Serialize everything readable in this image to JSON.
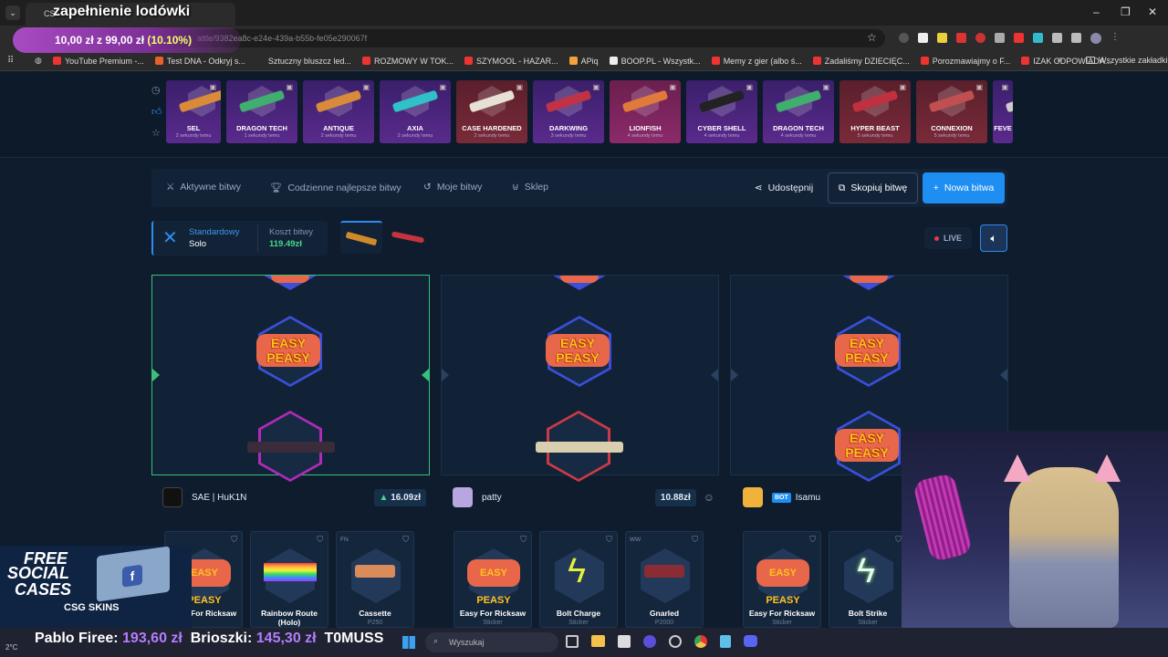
{
  "overlay": {
    "title": "zapełnienie lodówki",
    "goal_text": "10,00 zł z 99,00 zł",
    "goal_percent_text": "(10.10%)",
    "goal_fraction": 0.101
  },
  "browser": {
    "tab_title": "CS",
    "url": "attle/9382ea8c-e24e-439a-b55b-fe05e290067f",
    "bookmarks": [
      "YouTube Premium -...",
      "Test DNA - Odkryj s...",
      "Sztuczny bluszcz led...",
      "ROZMOWY W TOK...",
      "SZYMOOL - HAZAR...",
      "APiq",
      "BOOP.PL - Wszystk...",
      "Memy z gier (albo ś...",
      "Zadaliśmy DZIECIĘC...",
      "Porozmawiajmy o F...",
      "IZAK ODPOWIADA..."
    ],
    "all_bookmarks": "Wszystkie zakładki"
  },
  "recent_cases": [
    {
      "name": "SEL",
      "time": "2 sekundy temu"
    },
    {
      "name": "DRAGON TECH",
      "time": "1 sekundy temu"
    },
    {
      "name": "ANTIQUE",
      "time": "2 sekundy temu"
    },
    {
      "name": "AXIA",
      "time": "2 sekundy temu"
    },
    {
      "name": "CASE HARDENED",
      "time": "2 sekundy temu"
    },
    {
      "name": "DARKWING",
      "time": "3 sekundy temu"
    },
    {
      "name": "LIONFISH",
      "time": "4 sekundy temu"
    },
    {
      "name": "CYBER SHELL",
      "time": "4 sekundy temu"
    },
    {
      "name": "DRAGON TECH",
      "time": "4 sekundy temu"
    },
    {
      "name": "HYPER BEAST",
      "time": "5 sekundy temu"
    },
    {
      "name": "CONNEXION",
      "time": "5 sekundy temu"
    },
    {
      "name": "FEVE",
      "time": ""
    }
  ],
  "nav": {
    "active_battles": "Aktywne bitwy",
    "daily_best": "Codzienne najlepsze bitwy",
    "my_battles": "Moje bitwy",
    "shop": "Sklep",
    "share": "Udostępnij",
    "copy_battle": "Skopiuj bitwę",
    "new_battle": "Nowa bitwa"
  },
  "battle": {
    "mode": "Standardowy",
    "type": "Solo",
    "cost_label": "Koszt bitwy",
    "cost": "119.49zł",
    "live": "LIVE"
  },
  "players": [
    {
      "name": "SAE | HuK1N",
      "value": "16.09zł",
      "bot": false
    },
    {
      "name": "patty",
      "value": "10.88zł",
      "bot": false
    },
    {
      "name": "Isamu",
      "value": "",
      "bot": true,
      "bot_label": "BOT"
    }
  ],
  "reel_sticker": "EASY PEASY",
  "items": {
    "p1": [
      {
        "name": "Easy For Ricksaw",
        "sub": "",
        "tag": ""
      },
      {
        "name": "Rainbow Route (Holo)",
        "sub": "",
        "tag": ""
      },
      {
        "name": "Cassette",
        "sub": "P250",
        "tag": "FN"
      }
    ],
    "p2": [
      {
        "name": "Easy For Ricksaw",
        "sub": "Sticker",
        "tag": ""
      },
      {
        "name": "Bolt Charge",
        "sub": "Sticker",
        "tag": ""
      },
      {
        "name": "Gnarled",
        "sub": "P2000",
        "tag": "WW"
      }
    ],
    "p3": [
      {
        "name": "Easy For Ricksaw",
        "sub": "Sticker",
        "tag": ""
      },
      {
        "name": "Bolt Strike",
        "sub": "Sticker",
        "tag": ""
      }
    ]
  },
  "promo": {
    "line1": "FREE",
    "line2": "SOCIAL",
    "line3": "CASES",
    "brand": "CSG SKINS"
  },
  "ticker": [
    {
      "name": "Pablo Firee:",
      "amount": "193,60 zł"
    },
    {
      "name": "Brioszki:",
      "amount": "145,30 zł"
    },
    {
      "name": "T0MUSS",
      "amount": ""
    }
  ],
  "taskbar": {
    "search_placeholder": "Wyszukaj",
    "temp": "2°C"
  },
  "colors": {
    "accent_blue": "#1e8ef2",
    "active_green": "#3ac07a",
    "value_green": "#45d98b",
    "case_purple": "#5a2a8c"
  }
}
